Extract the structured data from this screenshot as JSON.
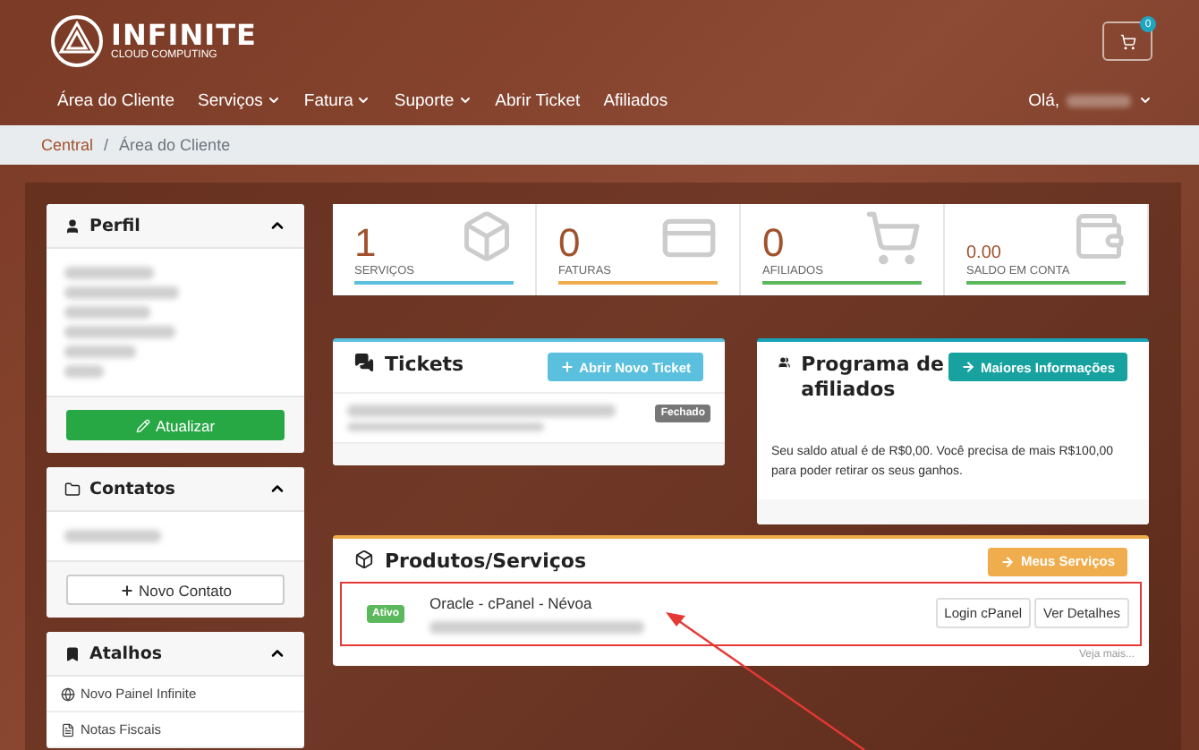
{
  "header": {
    "brand": "INFINITE",
    "tagline": "CLOUD COMPUTING",
    "cart_count": "0",
    "nav": [
      {
        "label": "Área do Cliente",
        "dropdown": false
      },
      {
        "label": "Serviços",
        "dropdown": true
      },
      {
        "label": "Fatura",
        "dropdown": true
      },
      {
        "label": "Suporte",
        "dropdown": true
      },
      {
        "label": "Abrir Ticket",
        "dropdown": false
      },
      {
        "label": "Afiliados",
        "dropdown": false
      }
    ],
    "greeting": "Olá,"
  },
  "breadcrumb": {
    "separator": "/",
    "items": [
      {
        "label": "Central",
        "link": true
      },
      {
        "label": "Área do Cliente",
        "link": false
      }
    ]
  },
  "sidebar": {
    "profile": {
      "title": "Perfil",
      "button": "Atualizar"
    },
    "contacts": {
      "title": "Contatos",
      "button": "Novo Contato"
    },
    "shortcuts": {
      "title": "Atalhos",
      "items": [
        {
          "label": "Novo Painel Infinite",
          "kind": "globe"
        },
        {
          "label": "Notas Fiscais",
          "kind": "file"
        }
      ]
    }
  },
  "stats": [
    {
      "value": "1",
      "label": "SERVIÇOS",
      "color": "#5bc0de",
      "kind": "box"
    },
    {
      "value": "0",
      "label": "FATURAS",
      "color": "#f0ad4e",
      "kind": "card"
    },
    {
      "value": "0",
      "label": "AFILIADOS",
      "color": "#5cb85c",
      "kind": "cart"
    },
    {
      "value": "0.00",
      "label": "SALDO EM CONTA",
      "color": "#5cb85c",
      "kind": "wallet"
    }
  ],
  "tickets": {
    "title": "Tickets",
    "button": "Abrir Novo Ticket",
    "items": [
      {
        "status": "Fechado"
      }
    ]
  },
  "affiliates": {
    "title": "Programa de afiliados",
    "button": "Maiores Informações",
    "text": "Seu saldo atual é de R$0,00. Você precisa de mais R$100,00 para poder retirar os seus ganhos."
  },
  "products": {
    "title": "Produtos/Serviços",
    "button": "Meus Serviços",
    "services": [
      {
        "status": "Ativo",
        "name": "Oracle - cPanel - Névoa",
        "highlighted": true,
        "actions": [
          "Login cPanel",
          "Ver Detalhes"
        ]
      }
    ],
    "more": "Veja mais..."
  }
}
